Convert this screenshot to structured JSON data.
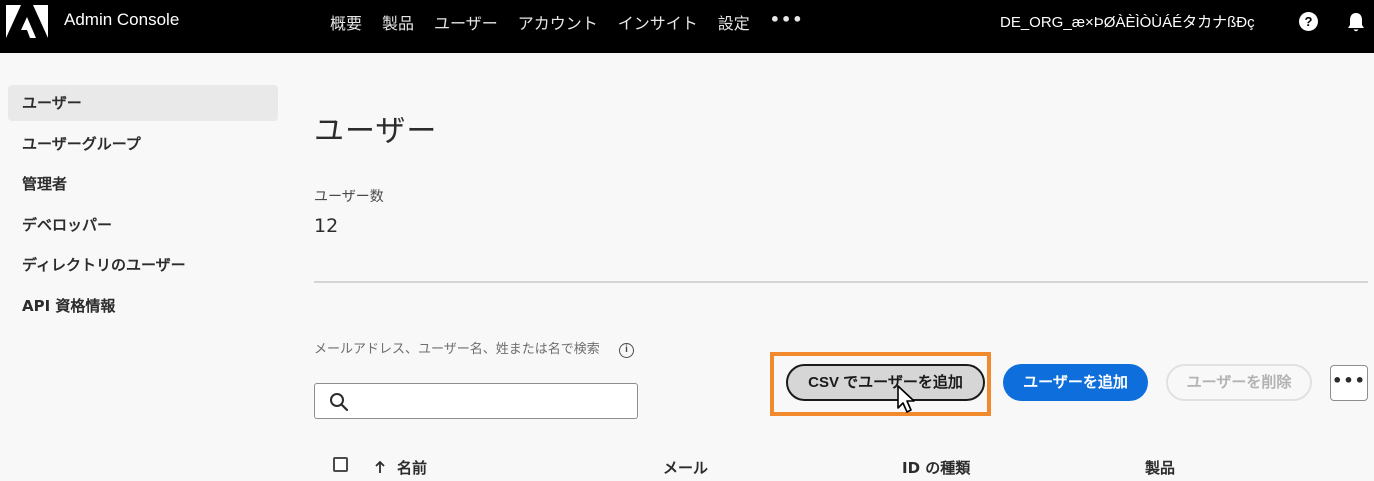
{
  "header": {
    "app_title": "Admin Console",
    "nav": [
      "概要",
      "製品",
      "ユーザー",
      "アカウント",
      "インサイト",
      "設定"
    ],
    "more_label": "•••",
    "org_name": "DE_ORG_æ×ÞØÀÈÌÒÙÁÉタカナßĐç"
  },
  "sidebar": {
    "items": [
      {
        "label": "ユーザー",
        "active": true
      },
      {
        "label": "ユーザーグループ"
      },
      {
        "label": "管理者"
      },
      {
        "label": "デベロッパー"
      },
      {
        "label": "ディレクトリのユーザー"
      },
      {
        "label": "API 資格情報"
      }
    ]
  },
  "main": {
    "title": "ユーザー",
    "count_label": "ユーザー数",
    "count_value": "12",
    "search": {
      "label": "メールアドレス、ユーザー名、姓または名で検索",
      "value": "",
      "placeholder": ""
    },
    "buttons": {
      "csv": "CSV でユーザーを追加",
      "add_user": "ユーザーを追加",
      "delete_user": "ユーザーを削除",
      "more": "•••"
    },
    "table": {
      "columns": [
        "名前",
        "メール",
        "ID の種類",
        "製品"
      ],
      "sorted_column": "名前"
    }
  },
  "colors": {
    "topbar": "#000000",
    "accent": "#0e6fdc",
    "highlight": "#f08a2d"
  },
  "icons": [
    "adobe-logo-icon",
    "help-icon",
    "bell-icon",
    "info-icon",
    "search-icon",
    "mouse-cursor-icon",
    "sort-ascending-icon",
    "more-icon"
  ]
}
